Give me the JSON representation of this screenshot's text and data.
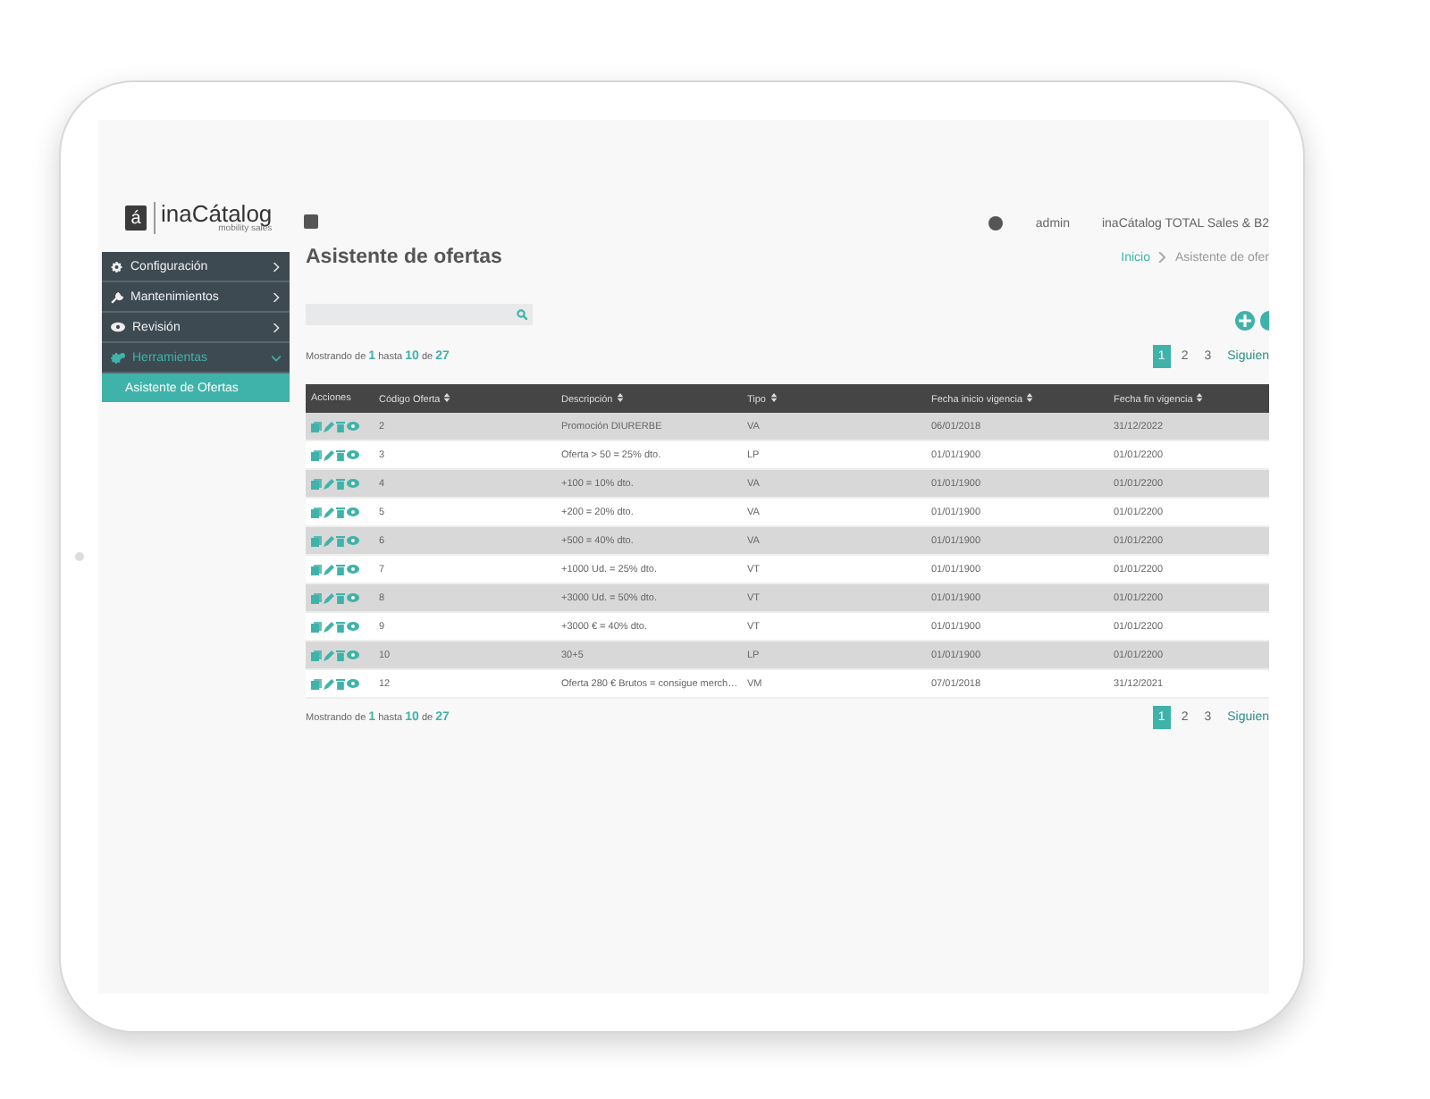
{
  "header": {
    "logo_mark": "á",
    "logo_text": "inaCátalog",
    "logo_tagline": "mobility sales",
    "user": "admin",
    "app_name": "inaCátalog TOTAL Sales & B2"
  },
  "sidebar": {
    "items": [
      {
        "label": "Configuración",
        "kind": "gear",
        "expanded": false
      },
      {
        "label": "Mantenimientos",
        "kind": "wrench",
        "expanded": false
      },
      {
        "label": "Revisión",
        "kind": "eye",
        "expanded": false
      },
      {
        "label": "Herramientas",
        "kind": "gears",
        "expanded": true,
        "children": [
          {
            "label": "Asistente de Ofertas",
            "selected": true
          }
        ]
      }
    ]
  },
  "page": {
    "title": "Asistente de ofertas",
    "breadcrumb": [
      "Inicio",
      "Asistente de ofer"
    ]
  },
  "summary_top": {
    "prefix": "Mostrando de",
    "from": "1",
    "mid": "hasta",
    "to": "10",
    "of": "de",
    "total": "27"
  },
  "pagination_top": {
    "pages": [
      {
        "label": "1",
        "selected": true
      },
      {
        "label": "2",
        "selected": false
      },
      {
        "label": "3",
        "selected": false
      }
    ],
    "next": "Siguien"
  },
  "table": {
    "columns": [
      "Acciones",
      "Código Oferta",
      "Descripción",
      "Tipo",
      "Fecha inicio vigencia",
      "Fecha fin vigencia"
    ],
    "rows": [
      {
        "code": "2",
        "description": "Promoción DIURERBE",
        "type": "VA",
        "start": "06/01/2018",
        "end": "31/12/2022"
      },
      {
        "code": "3",
        "description": "Oferta > 50 = 25% dto.",
        "type": "LP",
        "start": "01/01/1900",
        "end": "01/01/2200"
      },
      {
        "code": "4",
        "description": "+100 = 10% dto.",
        "type": "VA",
        "start": "01/01/1900",
        "end": "01/01/2200"
      },
      {
        "code": "5",
        "description": "+200 = 20% dto.",
        "type": "VA",
        "start": "01/01/1900",
        "end": "01/01/2200"
      },
      {
        "code": "6",
        "description": "+500 = 40% dto.",
        "type": "VA",
        "start": "01/01/1900",
        "end": "01/01/2200"
      },
      {
        "code": "7",
        "description": "+1000 Ud. = 25% dto.",
        "type": "VT",
        "start": "01/01/1900",
        "end": "01/01/2200"
      },
      {
        "code": "8",
        "description": "+3000 Ud. = 50% dto.",
        "type": "VT",
        "start": "01/01/1900",
        "end": "01/01/2200"
      },
      {
        "code": "9",
        "description": "+3000 € = 40% dto.",
        "type": "VT",
        "start": "01/01/1900",
        "end": "01/01/2200"
      },
      {
        "code": "10",
        "description": "30+5",
        "type": "LP",
        "start": "01/01/1900",
        "end": "01/01/2200"
      },
      {
        "code": "12",
        "description": "Oferta 280 € Brutos = consigue merch…",
        "type": "VM",
        "start": "07/01/2018",
        "end": "31/12/2021"
      }
    ]
  },
  "summary_bottom": {
    "prefix": "Mostrando de",
    "from": "1",
    "mid": "hasta",
    "to": "10",
    "of": "de",
    "total": "27"
  },
  "pagination_bottom": {
    "pages": [
      {
        "label": "1",
        "selected": true
      },
      {
        "label": "2",
        "selected": false
      },
      {
        "label": "3",
        "selected": false
      }
    ],
    "next": "Siguien"
  }
}
